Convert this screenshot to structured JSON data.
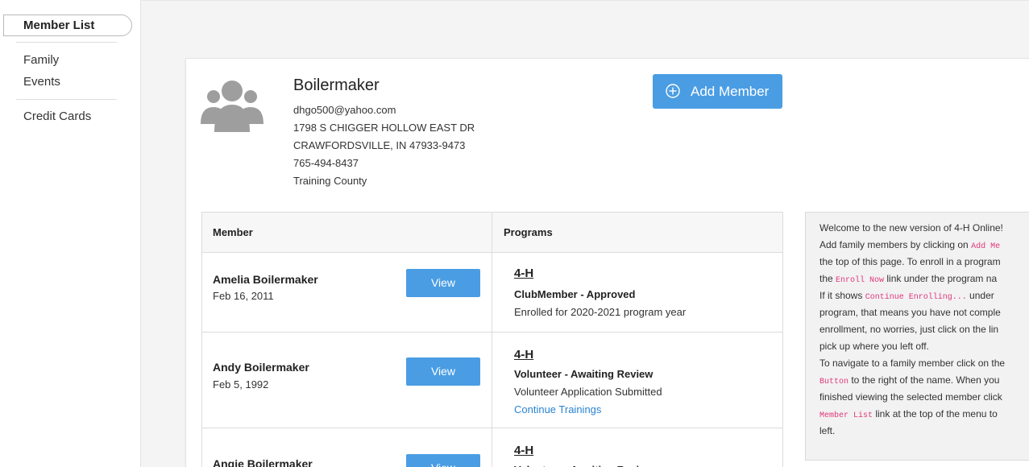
{
  "sidebar": {
    "active": "Member List",
    "items": [
      "Family",
      "Events"
    ],
    "items2": [
      "Credit Cards"
    ]
  },
  "family": {
    "name": "Boilermaker",
    "email": "dhgo500@yahoo.com",
    "address1": "1798 S CHIGGER HOLLOW EAST DR",
    "address2": "CRAWFORDSVILLE, IN 47933-9473",
    "phone": "765-494-8437",
    "county": "Training County"
  },
  "add_member_label": "Add Member",
  "table": {
    "col_member": "Member",
    "col_programs": "Programs",
    "view_label": "View",
    "rows": [
      {
        "name": "Amelia Boilermaker",
        "dob": "Feb 16, 2011",
        "program": "4-H",
        "role": "ClubMember - Approved",
        "note": "Enrolled for 2020-2021 program year",
        "link": ""
      },
      {
        "name": "Andy Boilermaker",
        "dob": "Feb 5, 1992",
        "program": "4-H",
        "role": "Volunteer - Awaiting Review",
        "note": "Volunteer Application Submitted",
        "link": "Continue Trainings"
      },
      {
        "name": "Angie Boilermaker",
        "dob": "",
        "program": "4-H",
        "role": "Volunteer - Awaiting Review",
        "note": "",
        "link": ""
      }
    ]
  },
  "info": {
    "l1": "Welcome to the new version of 4-H Online!",
    "l2a": "Add family members by clicking on ",
    "l2b": "Add Me",
    "l3": "the top of this page. To enroll in a program",
    "l4a": "the ",
    "l4b": "Enroll Now",
    "l4c": " link under the program na",
    "l5a": "If it shows ",
    "l5b": "Continue Enrolling...",
    "l5c": " under",
    "l6": "program, that means you have not comple",
    "l7": "enrollment, no worries, just click on the lin",
    "l8": "pick up where you left off.",
    "l9": "To navigate to a family member click on the",
    "l10a": "Button",
    "l10b": " to the right of the name. When you",
    "l11": "finished viewing the selected member click",
    "l12a": "Member List",
    "l12b": " link at the top of the menu to",
    "l13": "left."
  },
  "colors": {
    "accent": "#4a9de3",
    "link": "#2a84d2",
    "code": "#e0367a"
  }
}
